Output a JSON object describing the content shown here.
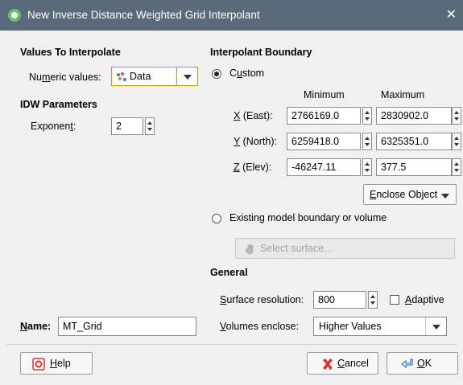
{
  "window": {
    "title": "New Inverse Distance Weighted Grid Interpolant",
    "close_glyph": "✕"
  },
  "values_to_interpolate": {
    "heading": "Values To Interpolate",
    "numeric_label_pre": "Nu",
    "numeric_label_u": "m",
    "numeric_label_post": "eric values:",
    "numeric_value": "Data"
  },
  "idw": {
    "heading": "IDW Parameters",
    "exponent_label_pre": "Exponen",
    "exponent_label_u": "t",
    "exponent_label_post": ":",
    "exponent_value": "2"
  },
  "boundary": {
    "heading": "Interpolant Boundary",
    "custom_pre": "C",
    "custom_u": "u",
    "custom_post": "stom",
    "minimum_header": "Minimum",
    "maximum_header": "Maximum",
    "rows": [
      {
        "label_u": "X",
        "label_rest": " (East):",
        "min": "2766169.0",
        "max": "2830902.0"
      },
      {
        "label_u": "Y",
        "label_rest": " (North):",
        "min": "6259418.0",
        "max": "6325351.0"
      },
      {
        "label_u": "Z",
        "label_rest": " (Elev):",
        "min": "-46247.11",
        "max": "377.5"
      }
    ],
    "enclose_u": "E",
    "enclose_rest": "nclose Object",
    "existing_label": "Existing model boundary or volume",
    "select_surface_label": "Select surface..."
  },
  "general": {
    "heading": "General",
    "resolution_u": "S",
    "resolution_rest": "urface resolution:",
    "resolution_value": "800",
    "adaptive_u": "A",
    "adaptive_rest": "daptive",
    "volumes_u": "V",
    "volumes_rest": "olumes enclose:",
    "volumes_value": "Higher Values"
  },
  "name": {
    "label_u": "N",
    "label_rest": "ame:",
    "value": "MT_Grid"
  },
  "footer": {
    "help_u": "H",
    "help_rest": "elp",
    "cancel_u": "C",
    "cancel_rest": "ancel",
    "ok_u": "O",
    "ok_rest": "K"
  },
  "colors": {
    "titlebar": "#5a6a7a",
    "accent": "#e38a1b",
    "cancel": "#d9342b",
    "ok": "#3b7dd8"
  },
  "icons": [
    "app-logo-icon",
    "data-points-icon",
    "hand-icon",
    "help-lifebuoy-icon",
    "cancel-x-icon",
    "ok-arrow-icon"
  ]
}
